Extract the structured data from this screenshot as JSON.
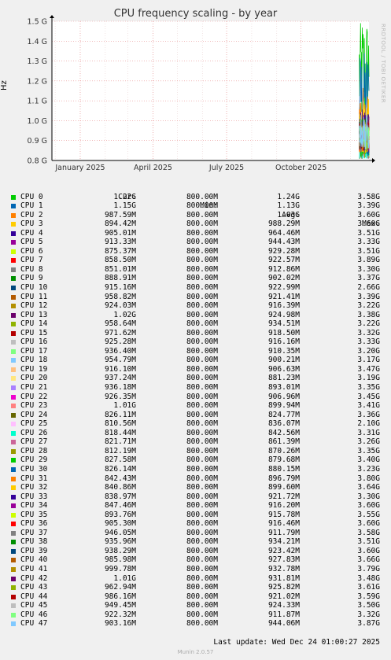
{
  "chart_data": {
    "type": "line",
    "title": "CPU frequency scaling - by year",
    "ylabel": "Hz",
    "watermark": "RRDTOOL / TOBI OETIKER",
    "ylim": [
      0.8,
      1.5
    ],
    "yticks": [
      {
        "v": 0.8,
        "label": "0.8 G"
      },
      {
        "v": 0.9,
        "label": "0.9 G"
      },
      {
        "v": 1.0,
        "label": "1.0 G"
      },
      {
        "v": 1.1,
        "label": "1.1 G"
      },
      {
        "v": 1.2,
        "label": "1.2 G"
      },
      {
        "v": 1.3,
        "label": "1.3 G"
      },
      {
        "v": 1.4,
        "label": "1.4 G"
      },
      {
        "v": 1.5,
        "label": "1.5 G"
      }
    ],
    "xlim": [
      "2024-11-27",
      "2025-12-24"
    ],
    "xticks": [
      {
        "date": "2025-01-01",
        "label": "January 2025"
      },
      {
        "date": "2025-04-01",
        "label": "April 2025"
      },
      {
        "date": "2025-07-01",
        "label": "July 2025"
      },
      {
        "date": "2025-10-01",
        "label": "October 2025"
      }
    ],
    "data_start": "2025-12-12",
    "grid": true,
    "legend_columns": [
      "Cur:",
      "Min:",
      "Avg:",
      "Max:"
    ],
    "series": [
      {
        "name": "CPU 0",
        "color": "#00cc00",
        "cur": "1.22G",
        "min": "800.00M",
        "avg": "1.24G",
        "max": "3.58G"
      },
      {
        "name": "CPU 1",
        "color": "#0066b3",
        "cur": "1.15G",
        "min": "800.00M",
        "avg": "1.13G",
        "max": "3.39G"
      },
      {
        "name": "CPU 2",
        "color": "#ff8000",
        "cur": "987.59M",
        "min": "800.00M",
        "avg": "1.03G",
        "max": "3.60G"
      },
      {
        "name": "CPU 3",
        "color": "#ffcc00",
        "cur": "894.42M",
        "min": "800.00M",
        "avg": "988.29M",
        "max": "3.60G"
      },
      {
        "name": "CPU 4",
        "color": "#330099",
        "cur": "905.01M",
        "min": "800.00M",
        "avg": "964.46M",
        "max": "3.51G"
      },
      {
        "name": "CPU 5",
        "color": "#990099",
        "cur": "913.33M",
        "min": "800.00M",
        "avg": "944.43M",
        "max": "3.33G"
      },
      {
        "name": "CPU 6",
        "color": "#ccff00",
        "cur": "875.37M",
        "min": "800.00M",
        "avg": "929.28M",
        "max": "3.51G"
      },
      {
        "name": "CPU 7",
        "color": "#ff0000",
        "cur": "858.50M",
        "min": "800.00M",
        "avg": "922.57M",
        "max": "3.89G"
      },
      {
        "name": "CPU 8",
        "color": "#808080",
        "cur": "851.01M",
        "min": "800.00M",
        "avg": "912.86M",
        "max": "3.30G"
      },
      {
        "name": "CPU 9",
        "color": "#008f00",
        "cur": "888.91M",
        "min": "800.00M",
        "avg": "902.02M",
        "max": "3.37G"
      },
      {
        "name": "CPU 10",
        "color": "#00487d",
        "cur": "915.16M",
        "min": "800.00M",
        "avg": "922.99M",
        "max": "2.66G"
      },
      {
        "name": "CPU 11",
        "color": "#b35a00",
        "cur": "958.82M",
        "min": "800.00M",
        "avg": "921.41M",
        "max": "3.39G"
      },
      {
        "name": "CPU 12",
        "color": "#b38f00",
        "cur": "924.03M",
        "min": "800.00M",
        "avg": "916.39M",
        "max": "3.22G"
      },
      {
        "name": "CPU 13",
        "color": "#6b006b",
        "cur": "1.02G",
        "min": "800.00M",
        "avg": "924.98M",
        "max": "3.38G"
      },
      {
        "name": "CPU 14",
        "color": "#8fb300",
        "cur": "958.64M",
        "min": "800.00M",
        "avg": "934.51M",
        "max": "3.22G"
      },
      {
        "name": "CPU 15",
        "color": "#b30000",
        "cur": "971.62M",
        "min": "800.00M",
        "avg": "918.50M",
        "max": "3.32G"
      },
      {
        "name": "CPU 16",
        "color": "#bebebe",
        "cur": "925.28M",
        "min": "800.00M",
        "avg": "916.16M",
        "max": "3.33G"
      },
      {
        "name": "CPU 17",
        "color": "#80ff80",
        "cur": "936.40M",
        "min": "800.00M",
        "avg": "910.35M",
        "max": "3.20G"
      },
      {
        "name": "CPU 18",
        "color": "#80c9ff",
        "cur": "954.79M",
        "min": "800.00M",
        "avg": "900.21M",
        "max": "3.17G"
      },
      {
        "name": "CPU 19",
        "color": "#ffc080",
        "cur": "916.10M",
        "min": "800.00M",
        "avg": "906.63M",
        "max": "3.47G"
      },
      {
        "name": "CPU 20",
        "color": "#ffe680",
        "cur": "937.24M",
        "min": "800.00M",
        "avg": "881.23M",
        "max": "3.19G"
      },
      {
        "name": "CPU 21",
        "color": "#aa80ff",
        "cur": "936.18M",
        "min": "800.00M",
        "avg": "893.01M",
        "max": "3.35G"
      },
      {
        "name": "CPU 22",
        "color": "#ee00cc",
        "cur": "926.35M",
        "min": "800.00M",
        "avg": "906.96M",
        "max": "3.45G"
      },
      {
        "name": "CPU 23",
        "color": "#ff8080",
        "cur": "1.01G",
        "min": "800.00M",
        "avg": "899.94M",
        "max": "3.41G"
      },
      {
        "name": "CPU 24",
        "color": "#666600",
        "cur": "826.11M",
        "min": "800.00M",
        "avg": "824.77M",
        "max": "3.36G"
      },
      {
        "name": "CPU 25",
        "color": "#ffbfff",
        "cur": "810.56M",
        "min": "800.00M",
        "avg": "836.07M",
        "max": "2.10G"
      },
      {
        "name": "CPU 26",
        "color": "#00ffcc",
        "cur": "818.44M",
        "min": "800.00M",
        "avg": "842.56M",
        "max": "3.31G"
      },
      {
        "name": "CPU 27",
        "color": "#cc6699",
        "cur": "821.71M",
        "min": "800.00M",
        "avg": "861.39M",
        "max": "3.26G"
      },
      {
        "name": "CPU 28",
        "color": "#999900",
        "cur": "812.19M",
        "min": "800.00M",
        "avg": "870.26M",
        "max": "3.35G"
      },
      {
        "name": "CPU 29",
        "color": "#00cc00",
        "cur": "827.58M",
        "min": "800.00M",
        "avg": "879.68M",
        "max": "3.40G"
      },
      {
        "name": "CPU 30",
        "color": "#0066b3",
        "cur": "826.14M",
        "min": "800.00M",
        "avg": "880.15M",
        "max": "3.23G"
      },
      {
        "name": "CPU 31",
        "color": "#ff8000",
        "cur": "842.43M",
        "min": "800.00M",
        "avg": "896.79M",
        "max": "3.80G"
      },
      {
        "name": "CPU 32",
        "color": "#ffcc00",
        "cur": "840.86M",
        "min": "800.00M",
        "avg": "899.60M",
        "max": "3.64G"
      },
      {
        "name": "CPU 33",
        "color": "#330099",
        "cur": "838.97M",
        "min": "800.00M",
        "avg": "921.72M",
        "max": "3.30G"
      },
      {
        "name": "CPU 34",
        "color": "#990099",
        "cur": "847.46M",
        "min": "800.00M",
        "avg": "916.20M",
        "max": "3.60G"
      },
      {
        "name": "CPU 35",
        "color": "#ccff00",
        "cur": "893.76M",
        "min": "800.00M",
        "avg": "915.78M",
        "max": "3.55G"
      },
      {
        "name": "CPU 36",
        "color": "#ff0000",
        "cur": "905.30M",
        "min": "800.00M",
        "avg": "916.46M",
        "max": "3.60G"
      },
      {
        "name": "CPU 37",
        "color": "#808080",
        "cur": "946.05M",
        "min": "800.00M",
        "avg": "911.79M",
        "max": "3.58G"
      },
      {
        "name": "CPU 38",
        "color": "#008f00",
        "cur": "935.96M",
        "min": "800.00M",
        "avg": "934.21M",
        "max": "3.51G"
      },
      {
        "name": "CPU 39",
        "color": "#00487d",
        "cur": "938.29M",
        "min": "800.00M",
        "avg": "923.42M",
        "max": "3.60G"
      },
      {
        "name": "CPU 40",
        "color": "#b35a00",
        "cur": "985.98M",
        "min": "800.00M",
        "avg": "927.83M",
        "max": "3.66G"
      },
      {
        "name": "CPU 41",
        "color": "#b38f00",
        "cur": "999.78M",
        "min": "800.00M",
        "avg": "932.78M",
        "max": "3.79G"
      },
      {
        "name": "CPU 42",
        "color": "#6b006b",
        "cur": "1.01G",
        "min": "800.00M",
        "avg": "931.81M",
        "max": "3.48G"
      },
      {
        "name": "CPU 43",
        "color": "#8fb300",
        "cur": "962.94M",
        "min": "800.00M",
        "avg": "925.82M",
        "max": "3.61G"
      },
      {
        "name": "CPU 44",
        "color": "#b30000",
        "cur": "986.16M",
        "min": "800.00M",
        "avg": "921.02M",
        "max": "3.59G"
      },
      {
        "name": "CPU 45",
        "color": "#bebebe",
        "cur": "949.45M",
        "min": "800.00M",
        "avg": "924.33M",
        "max": "3.50G"
      },
      {
        "name": "CPU 46",
        "color": "#80ff80",
        "cur": "922.32M",
        "min": "800.00M",
        "avg": "911.87M",
        "max": "3.32G"
      },
      {
        "name": "CPU 47",
        "color": "#80c9ff",
        "cur": "903.16M",
        "min": "800.00M",
        "avg": "944.06M",
        "max": "3.87G"
      }
    ]
  },
  "last_update": "Last update: Wed Dec 24 01:00:27 2025",
  "footer": "Munin 2.0.57"
}
